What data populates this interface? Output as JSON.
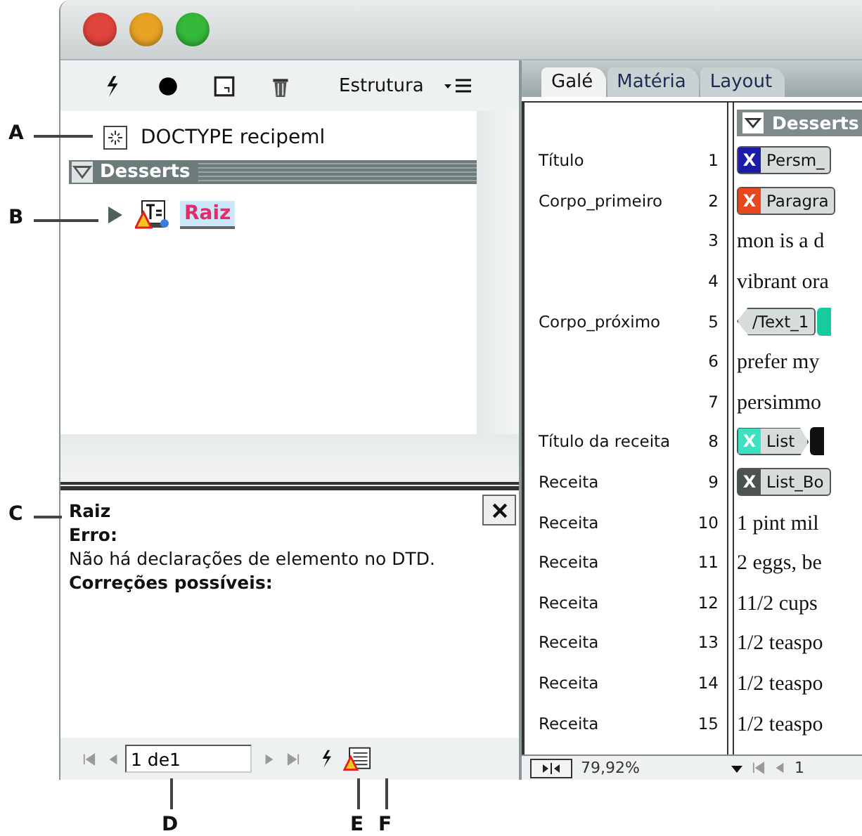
{
  "structure_panel": {
    "title": "Estrutura",
    "tree": [
      {
        "kind": "doctype",
        "label": "DOCTYPE recipeml"
      },
      {
        "kind": "section",
        "label": "Desserts",
        "expanded": true
      },
      {
        "kind": "element",
        "label": "Raiz",
        "expanded": false,
        "selected": true,
        "warning": true
      }
    ]
  },
  "error_panel": {
    "element": "Raiz",
    "heading": "Erro:",
    "message": "Não há declarações de elemento no DTD.",
    "fixes_heading": "Correções possíveis:",
    "page_field": "1 de1"
  },
  "story_editor": {
    "tabs": [
      {
        "label": "Galé",
        "selected": true
      },
      {
        "label": "Matéria",
        "selected": false
      },
      {
        "label": "Layout",
        "selected": false
      }
    ],
    "header": {
      "label": "Desserts",
      "expanded": true
    },
    "rows": [
      {
        "style": "Título",
        "number": "1",
        "kind": "tag",
        "mark": "X",
        "color": "#1c1ca6",
        "label": "Persm_"
      },
      {
        "style": "Corpo_primeiro",
        "number": "2",
        "kind": "tag",
        "mark": "X",
        "color": "#e8461e",
        "label": "Paragra"
      },
      {
        "number": "3",
        "kind": "text",
        "text": "mon is a d"
      },
      {
        "number": "4",
        "kind": "text",
        "text": "vibrant ora"
      },
      {
        "style": "Corpo_próximo",
        "number": "5",
        "kind": "endtag",
        "label": "/Text_1",
        "next": {
          "color": "#19c9a0"
        }
      },
      {
        "number": "6",
        "kind": "text",
        "text": "prefer my"
      },
      {
        "number": "7",
        "kind": "text",
        "text": "persimmo"
      },
      {
        "style": "Título da receita",
        "number": "8",
        "kind": "arrowtag",
        "mark": "X",
        "color": "#3de0c0",
        "label": "List",
        "next": {
          "color": "#111111"
        }
      },
      {
        "style": "Receita",
        "number": "9",
        "kind": "tag",
        "mark": "X",
        "color": "#4a5252",
        "label": "List_Bo"
      },
      {
        "style": "Receita",
        "number": "10",
        "kind": "text",
        "text": "1 pint mil"
      },
      {
        "style": "Receita",
        "number": "11",
        "kind": "text",
        "text": "2 eggs, be"
      },
      {
        "style": "Receita",
        "number": "12",
        "kind": "text",
        "text": "11/2 cups"
      },
      {
        "style": "Receita",
        "number": "13",
        "kind": "text",
        "text": "1/2 teaspo"
      },
      {
        "style": "Receita",
        "number": "14",
        "kind": "text",
        "text": "1/2 teaspo"
      },
      {
        "style": "Receita",
        "number": "15",
        "kind": "text",
        "text": "1/2 teaspo"
      }
    ],
    "zoom": "79,92%",
    "page": "1"
  },
  "callouts": [
    "A",
    "B",
    "C",
    "D",
    "E",
    "F"
  ]
}
